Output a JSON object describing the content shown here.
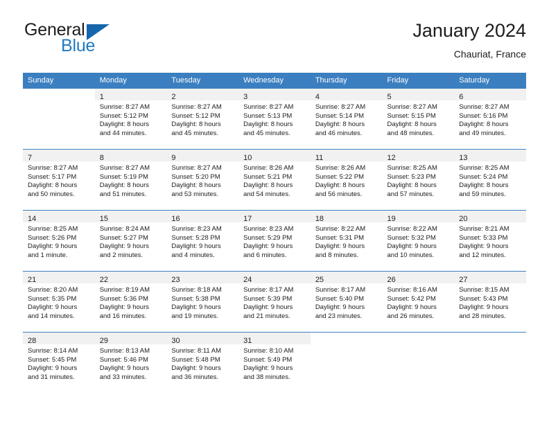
{
  "brand": {
    "name_part1": "General",
    "name_part2": "Blue",
    "flag_icon": "blue-flag-triangle-icon"
  },
  "header": {
    "title": "January 2024",
    "location": "Chauriat, France"
  },
  "colors": {
    "header_blue": "#3b7fc0",
    "brand_blue": "#1e7bc4",
    "flag_blue": "#1566ad",
    "daynum_band": "#f1f1f1",
    "text": "#1c1c1c"
  },
  "weekdays": [
    "Sunday",
    "Monday",
    "Tuesday",
    "Wednesday",
    "Thursday",
    "Friday",
    "Saturday"
  ],
  "labels": {
    "sunrise_prefix": "Sunrise:",
    "sunset_prefix": "Sunset:",
    "daylight_prefix": "Daylight:"
  },
  "weeks": [
    [
      {
        "day": "",
        "sunrise": "",
        "sunset": "",
        "daylight_line1": "",
        "daylight_line2": ""
      },
      {
        "day": "1",
        "sunrise": "Sunrise: 8:27 AM",
        "sunset": "Sunset: 5:12 PM",
        "daylight_line1": "Daylight: 8 hours",
        "daylight_line2": "and 44 minutes."
      },
      {
        "day": "2",
        "sunrise": "Sunrise: 8:27 AM",
        "sunset": "Sunset: 5:12 PM",
        "daylight_line1": "Daylight: 8 hours",
        "daylight_line2": "and 45 minutes."
      },
      {
        "day": "3",
        "sunrise": "Sunrise: 8:27 AM",
        "sunset": "Sunset: 5:13 PM",
        "daylight_line1": "Daylight: 8 hours",
        "daylight_line2": "and 45 minutes."
      },
      {
        "day": "4",
        "sunrise": "Sunrise: 8:27 AM",
        "sunset": "Sunset: 5:14 PM",
        "daylight_line1": "Daylight: 8 hours",
        "daylight_line2": "and 46 minutes."
      },
      {
        "day": "5",
        "sunrise": "Sunrise: 8:27 AM",
        "sunset": "Sunset: 5:15 PM",
        "daylight_line1": "Daylight: 8 hours",
        "daylight_line2": "and 48 minutes."
      },
      {
        "day": "6",
        "sunrise": "Sunrise: 8:27 AM",
        "sunset": "Sunset: 5:16 PM",
        "daylight_line1": "Daylight: 8 hours",
        "daylight_line2": "and 49 minutes."
      }
    ],
    [
      {
        "day": "7",
        "sunrise": "Sunrise: 8:27 AM",
        "sunset": "Sunset: 5:17 PM",
        "daylight_line1": "Daylight: 8 hours",
        "daylight_line2": "and 50 minutes."
      },
      {
        "day": "8",
        "sunrise": "Sunrise: 8:27 AM",
        "sunset": "Sunset: 5:19 PM",
        "daylight_line1": "Daylight: 8 hours",
        "daylight_line2": "and 51 minutes."
      },
      {
        "day": "9",
        "sunrise": "Sunrise: 8:27 AM",
        "sunset": "Sunset: 5:20 PM",
        "daylight_line1": "Daylight: 8 hours",
        "daylight_line2": "and 53 minutes."
      },
      {
        "day": "10",
        "sunrise": "Sunrise: 8:26 AM",
        "sunset": "Sunset: 5:21 PM",
        "daylight_line1": "Daylight: 8 hours",
        "daylight_line2": "and 54 minutes."
      },
      {
        "day": "11",
        "sunrise": "Sunrise: 8:26 AM",
        "sunset": "Sunset: 5:22 PM",
        "daylight_line1": "Daylight: 8 hours",
        "daylight_line2": "and 56 minutes."
      },
      {
        "day": "12",
        "sunrise": "Sunrise: 8:25 AM",
        "sunset": "Sunset: 5:23 PM",
        "daylight_line1": "Daylight: 8 hours",
        "daylight_line2": "and 57 minutes."
      },
      {
        "day": "13",
        "sunrise": "Sunrise: 8:25 AM",
        "sunset": "Sunset: 5:24 PM",
        "daylight_line1": "Daylight: 8 hours",
        "daylight_line2": "and 59 minutes."
      }
    ],
    [
      {
        "day": "14",
        "sunrise": "Sunrise: 8:25 AM",
        "sunset": "Sunset: 5:26 PM",
        "daylight_line1": "Daylight: 9 hours",
        "daylight_line2": "and 1 minute."
      },
      {
        "day": "15",
        "sunrise": "Sunrise: 8:24 AM",
        "sunset": "Sunset: 5:27 PM",
        "daylight_line1": "Daylight: 9 hours",
        "daylight_line2": "and 2 minutes."
      },
      {
        "day": "16",
        "sunrise": "Sunrise: 8:23 AM",
        "sunset": "Sunset: 5:28 PM",
        "daylight_line1": "Daylight: 9 hours",
        "daylight_line2": "and 4 minutes."
      },
      {
        "day": "17",
        "sunrise": "Sunrise: 8:23 AM",
        "sunset": "Sunset: 5:29 PM",
        "daylight_line1": "Daylight: 9 hours",
        "daylight_line2": "and 6 minutes."
      },
      {
        "day": "18",
        "sunrise": "Sunrise: 8:22 AM",
        "sunset": "Sunset: 5:31 PM",
        "daylight_line1": "Daylight: 9 hours",
        "daylight_line2": "and 8 minutes."
      },
      {
        "day": "19",
        "sunrise": "Sunrise: 8:22 AM",
        "sunset": "Sunset: 5:32 PM",
        "daylight_line1": "Daylight: 9 hours",
        "daylight_line2": "and 10 minutes."
      },
      {
        "day": "20",
        "sunrise": "Sunrise: 8:21 AM",
        "sunset": "Sunset: 5:33 PM",
        "daylight_line1": "Daylight: 9 hours",
        "daylight_line2": "and 12 minutes."
      }
    ],
    [
      {
        "day": "21",
        "sunrise": "Sunrise: 8:20 AM",
        "sunset": "Sunset: 5:35 PM",
        "daylight_line1": "Daylight: 9 hours",
        "daylight_line2": "and 14 minutes."
      },
      {
        "day": "22",
        "sunrise": "Sunrise: 8:19 AM",
        "sunset": "Sunset: 5:36 PM",
        "daylight_line1": "Daylight: 9 hours",
        "daylight_line2": "and 16 minutes."
      },
      {
        "day": "23",
        "sunrise": "Sunrise: 8:18 AM",
        "sunset": "Sunset: 5:38 PM",
        "daylight_line1": "Daylight: 9 hours",
        "daylight_line2": "and 19 minutes."
      },
      {
        "day": "24",
        "sunrise": "Sunrise: 8:17 AM",
        "sunset": "Sunset: 5:39 PM",
        "daylight_line1": "Daylight: 9 hours",
        "daylight_line2": "and 21 minutes."
      },
      {
        "day": "25",
        "sunrise": "Sunrise: 8:17 AM",
        "sunset": "Sunset: 5:40 PM",
        "daylight_line1": "Daylight: 9 hours",
        "daylight_line2": "and 23 minutes."
      },
      {
        "day": "26",
        "sunrise": "Sunrise: 8:16 AM",
        "sunset": "Sunset: 5:42 PM",
        "daylight_line1": "Daylight: 9 hours",
        "daylight_line2": "and 26 minutes."
      },
      {
        "day": "27",
        "sunrise": "Sunrise: 8:15 AM",
        "sunset": "Sunset: 5:43 PM",
        "daylight_line1": "Daylight: 9 hours",
        "daylight_line2": "and 28 minutes."
      }
    ],
    [
      {
        "day": "28",
        "sunrise": "Sunrise: 8:14 AM",
        "sunset": "Sunset: 5:45 PM",
        "daylight_line1": "Daylight: 9 hours",
        "daylight_line2": "and 31 minutes."
      },
      {
        "day": "29",
        "sunrise": "Sunrise: 8:13 AM",
        "sunset": "Sunset: 5:46 PM",
        "daylight_line1": "Daylight: 9 hours",
        "daylight_line2": "and 33 minutes."
      },
      {
        "day": "30",
        "sunrise": "Sunrise: 8:11 AM",
        "sunset": "Sunset: 5:48 PM",
        "daylight_line1": "Daylight: 9 hours",
        "daylight_line2": "and 36 minutes."
      },
      {
        "day": "31",
        "sunrise": "Sunrise: 8:10 AM",
        "sunset": "Sunset: 5:49 PM",
        "daylight_line1": "Daylight: 9 hours",
        "daylight_line2": "and 38 minutes."
      },
      {
        "day": "",
        "sunrise": "",
        "sunset": "",
        "daylight_line1": "",
        "daylight_line2": ""
      },
      {
        "day": "",
        "sunrise": "",
        "sunset": "",
        "daylight_line1": "",
        "daylight_line2": ""
      },
      {
        "day": "",
        "sunrise": "",
        "sunset": "",
        "daylight_line1": "",
        "daylight_line2": ""
      }
    ]
  ]
}
